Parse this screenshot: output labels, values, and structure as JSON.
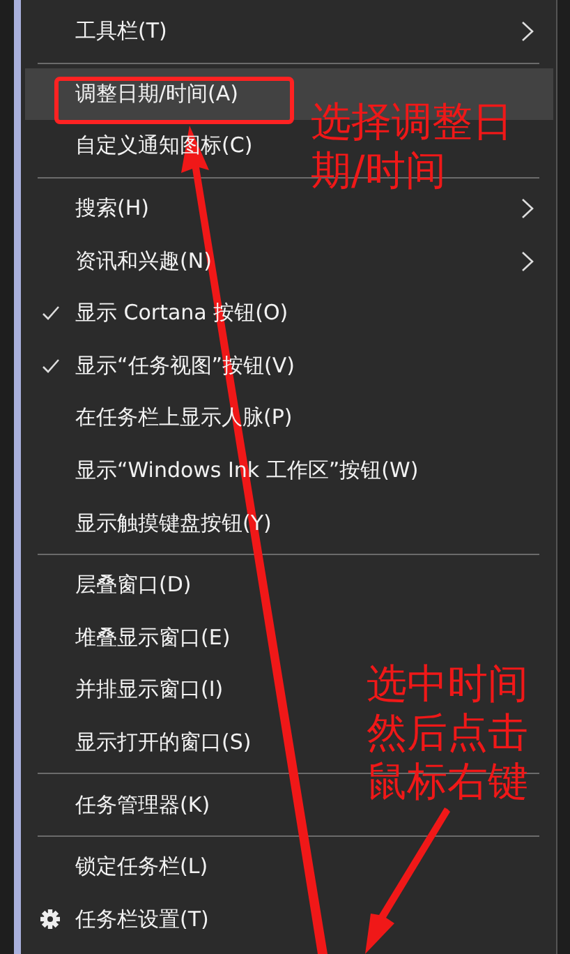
{
  "context_menu": {
    "groups": [
      {
        "items": [
          {
            "label": "工具栏(T)",
            "kind": "submenu",
            "checked": false,
            "selected": false
          }
        ]
      },
      {
        "items": [
          {
            "label": "调整日期/时间(A)",
            "kind": "item",
            "checked": false,
            "selected": true
          },
          {
            "label": "自定义通知图标(C)",
            "kind": "item",
            "checked": false,
            "selected": false
          }
        ]
      },
      {
        "items": [
          {
            "label": "搜索(H)",
            "kind": "submenu",
            "checked": false,
            "selected": false
          },
          {
            "label": "资讯和兴趣(N)",
            "kind": "submenu",
            "checked": false,
            "selected": false
          },
          {
            "label": "显示 Cortana 按钮(O)",
            "kind": "item",
            "checked": true,
            "selected": false
          },
          {
            "label": "显示“任务视图”按钮(V)",
            "kind": "item",
            "checked": true,
            "selected": false
          },
          {
            "label": "在任务栏上显示人脉(P)",
            "kind": "item",
            "checked": false,
            "selected": false
          },
          {
            "label": "显示“Windows Ink 工作区”按钮(W)",
            "kind": "item",
            "checked": false,
            "selected": false
          },
          {
            "label": "显示触摸键盘按钮(Y)",
            "kind": "item",
            "checked": false,
            "selected": false
          }
        ]
      },
      {
        "items": [
          {
            "label": "层叠窗口(D)",
            "kind": "item",
            "checked": false,
            "selected": false
          },
          {
            "label": "堆叠显示窗口(E)",
            "kind": "item",
            "checked": false,
            "selected": false
          },
          {
            "label": "并排显示窗口(I)",
            "kind": "item",
            "checked": false,
            "selected": false
          },
          {
            "label": "显示打开的窗口(S)",
            "kind": "item",
            "checked": false,
            "selected": false
          }
        ]
      },
      {
        "items": [
          {
            "label": "任务管理器(K)",
            "kind": "item",
            "checked": false,
            "selected": false
          }
        ]
      },
      {
        "items": [
          {
            "label": "锁定任务栏(L)",
            "kind": "item",
            "checked": false,
            "selected": false
          },
          {
            "label": "任务栏设置(T)",
            "kind": "settings",
            "checked": false,
            "selected": false
          }
        ]
      }
    ]
  },
  "annotations": [
    {
      "text": "选择调整日期/时间"
    },
    {
      "text": "选中时间然后点击鼠标右键"
    }
  ]
}
